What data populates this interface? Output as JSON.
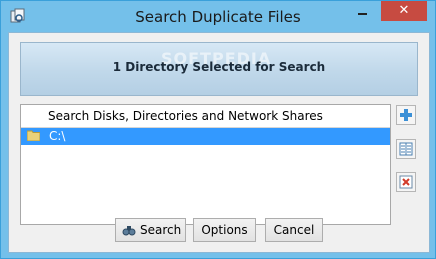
{
  "window": {
    "title": "Search Duplicate Files",
    "close_glyph": "✕"
  },
  "icons": {
    "app": "search-duplicates-icon",
    "add": "plus-icon",
    "browse": "folder-list-icon",
    "remove": "remove-icon",
    "folder": "folder-icon",
    "search_button": "binoculars-icon"
  },
  "banner": {
    "text": "1 Directory Selected for Search",
    "watermark": "SOFTPEDIA"
  },
  "list": {
    "header": "Search Disks, Directories and Network Shares",
    "items": [
      {
        "label": "C:\\",
        "selected": true
      }
    ]
  },
  "buttons": {
    "search": "Search",
    "options": "Options",
    "cancel": "Cancel"
  },
  "colors": {
    "titlebar": "#74c0ea",
    "close": "#c74b41",
    "selection": "#3399ff"
  }
}
